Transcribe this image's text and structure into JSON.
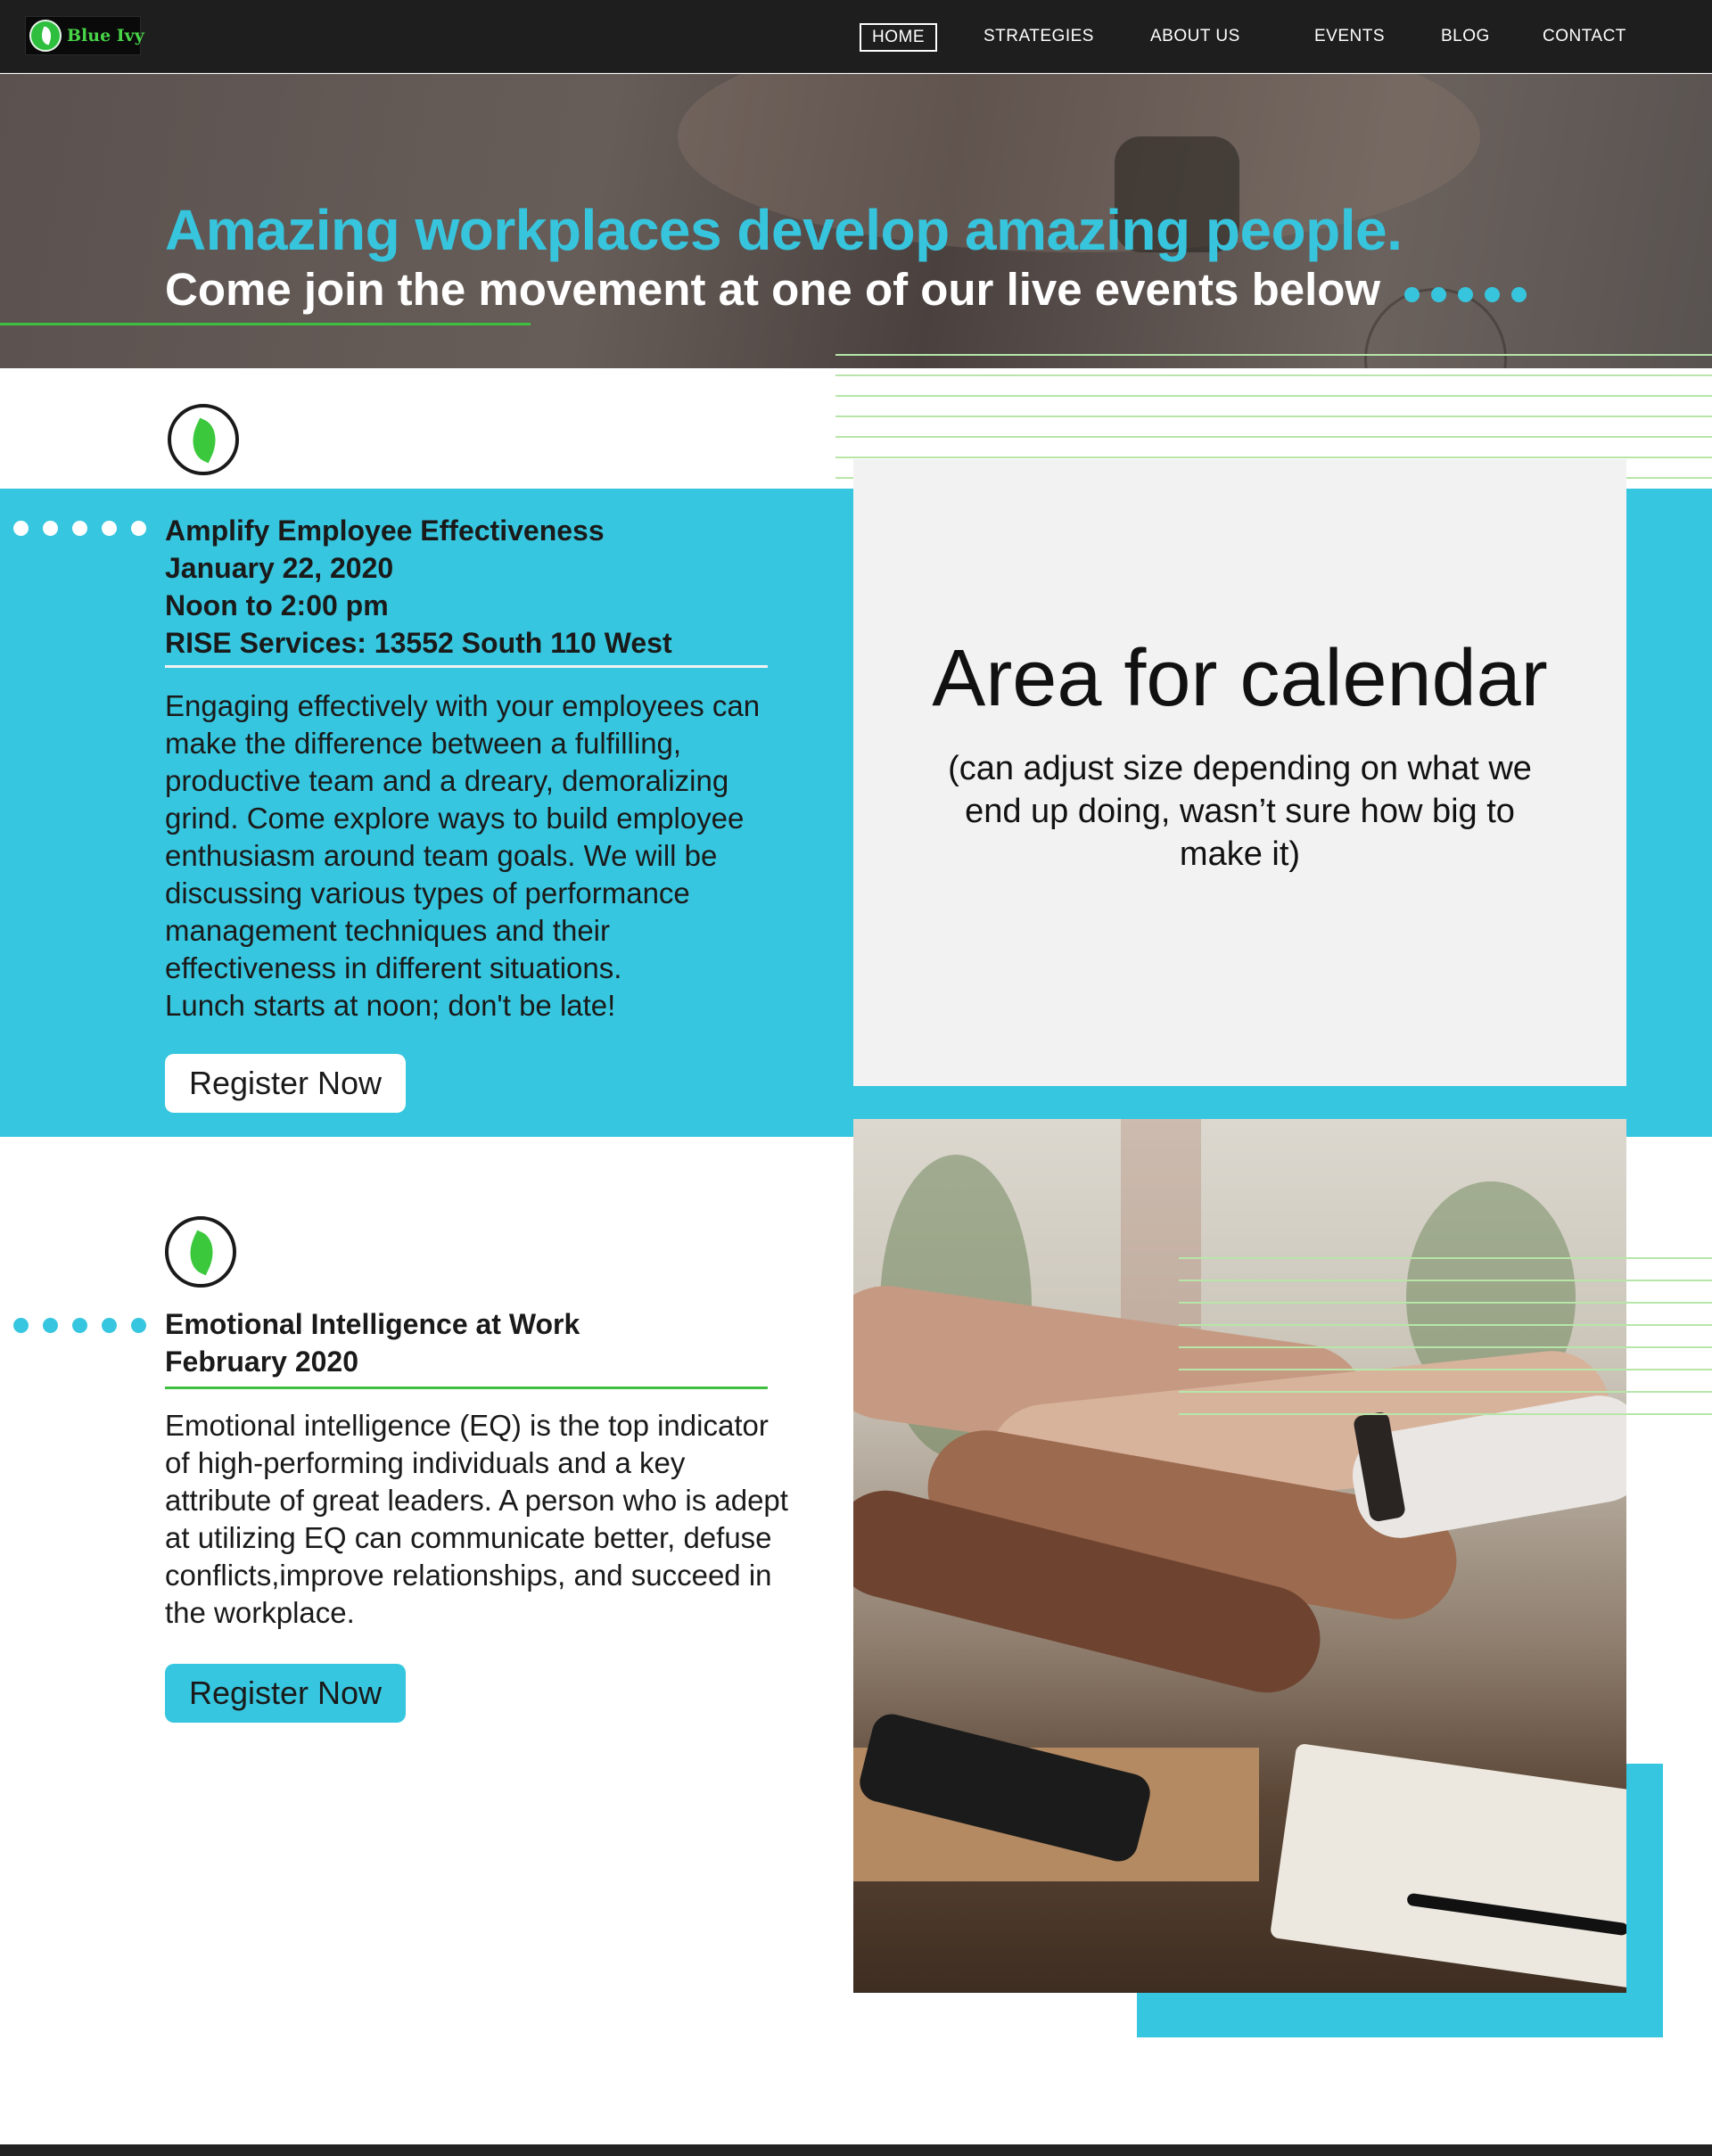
{
  "nav": {
    "logo_text": "Blue Ivy",
    "items": [
      "HOME",
      "STRATEGIES",
      "ABOUT US",
      "EVENTS",
      "BLOG",
      "CONTACT"
    ],
    "active": "HOME"
  },
  "hero": {
    "headline": "Amazing workplaces develop amazing people.",
    "subheadline": "Come join the movement at one of our live events below"
  },
  "events": [
    {
      "title_lines": [
        "Amplify Employee Effectiveness",
        "January 22, 2020",
        "Noon to 2:00 pm",
        "RISE Services: 13552 South 110 West"
      ],
      "description": "Engaging effectively with your employees can make the difference between a fulfilling, productive team and a dreary, demoralizing grind. Come explore ways to build employee enthusiasm around team goals. We will be discussing various types of performance management techniques and their effectiveness in different situations.",
      "note": "Lunch starts at noon; don't be late!",
      "button_label": "Register Now"
    },
    {
      "title_lines": [
        "Emotional Intelligence at Work",
        "February 2020"
      ],
      "description": "Emotional intelligence (EQ) is the top indicator of high-performing individuals and a key attribute of great leaders. A person who is adept at utilizing EQ can communicate better, defuse conflicts,improve relationships, and succeed in the workplace.",
      "button_label": "Register Now"
    }
  ],
  "calendar": {
    "title": "Area for calendar",
    "subtitle": "(can adjust size depending on what we end up doing, wasn’t sure how big to make it)"
  },
  "colors": {
    "accent": "#37c6df",
    "green": "#3fbf3f",
    "nav_bg": "#1e1e1e"
  }
}
